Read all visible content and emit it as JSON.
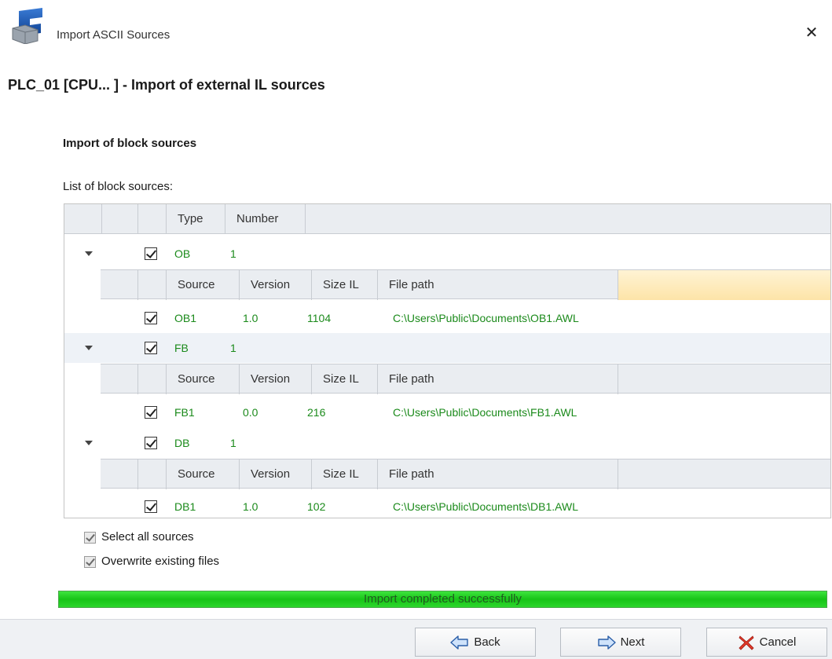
{
  "window": {
    "title": "Import ASCII Sources",
    "close_glyph": "✕"
  },
  "page_title": "PLC_01 [CPU... ]  - Import of external IL sources",
  "section_title": "Import of block sources",
  "list_label": "List of block sources:",
  "table": {
    "top_headers": [
      "Type",
      "Number"
    ],
    "sub_headers": [
      "Source",
      "Version",
      "Size IL",
      "File path"
    ],
    "groups": [
      {
        "type": "OB",
        "number": "1",
        "expanded": true,
        "checked": true,
        "sources": [
          {
            "source": "OB1",
            "version": "1.0",
            "size": "1104",
            "path": "C:\\Users\\Public\\Documents\\OB1.AWL",
            "checked": true
          }
        ]
      },
      {
        "type": "FB",
        "number": "1",
        "expanded": true,
        "checked": true,
        "sources": [
          {
            "source": "FB1",
            "version": "0.0",
            "size": "216",
            "path": "C:\\Users\\Public\\Documents\\FB1.AWL",
            "checked": true
          }
        ]
      },
      {
        "type": "DB",
        "number": "1",
        "expanded": true,
        "checked": true,
        "sources": [
          {
            "source": "DB1",
            "version": "1.0",
            "size": "102",
            "path": "C:\\Users\\Public\\Documents\\DB1.AWL",
            "checked": true
          }
        ]
      }
    ]
  },
  "options": {
    "select_all": {
      "label": "Select all sources",
      "checked": true
    },
    "overwrite": {
      "label": "Overwrite existing files",
      "checked": true
    }
  },
  "progress": {
    "text": "Import completed successfully",
    "value": 1.0
  },
  "buttons": {
    "back": "Back",
    "next": "Next",
    "cancel": "Cancel"
  },
  "colors": {
    "value_green": "#1b8a1b",
    "highlight": "#fde7b0",
    "progress": "#17c417"
  },
  "icons": {
    "app": "tia-portal-icon",
    "back": "back-arrow-icon",
    "next": "next-arrow-icon",
    "cancel": "red-x-icon"
  }
}
